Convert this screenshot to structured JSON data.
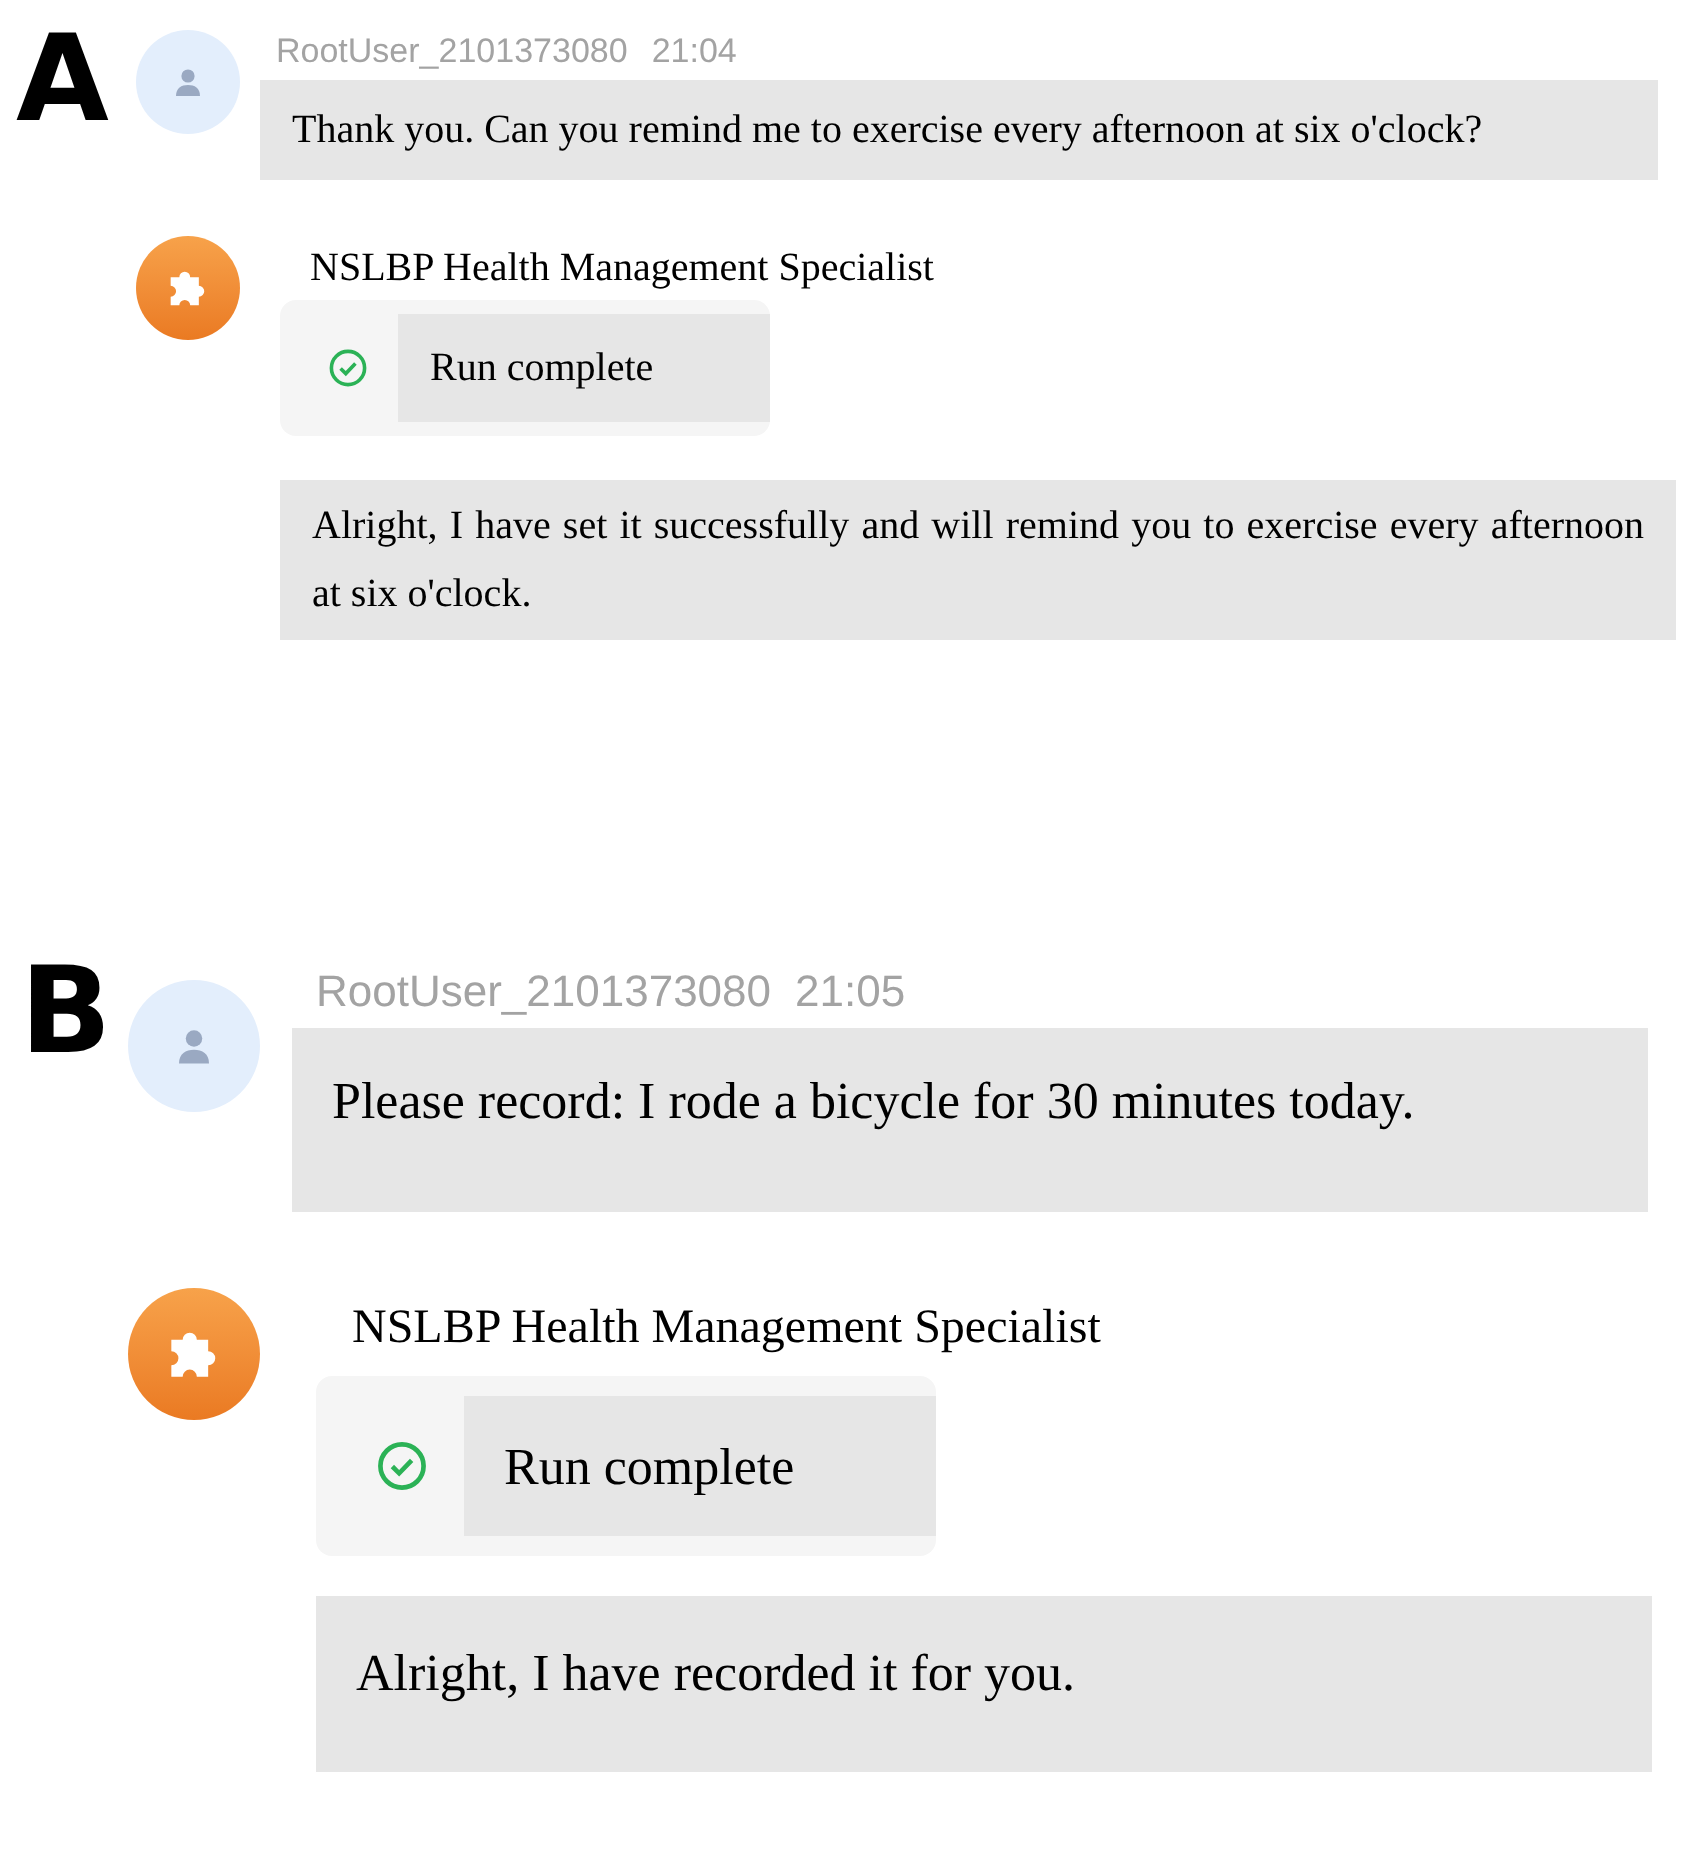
{
  "panels": [
    {
      "label": "A",
      "user": {
        "username": "RootUser_2101373080",
        "time": "21:04",
        "text": "Thank you. Can you remind me to exercise every afternoon at six o'clock?"
      },
      "bot": {
        "name": "NSLBP Health Management Specialist",
        "status": "Run complete",
        "reply": "Alright, I have set it successfully and will remind you to exercise every afternoon at six o'clock."
      }
    },
    {
      "label": "B",
      "user": {
        "username": "RootUser_2101373080",
        "time": "21:05",
        "text": "Please record: I rode a bicycle for 30 minutes today."
      },
      "bot": {
        "name": "NSLBP Health Management Specialist",
        "status": "Run complete",
        "reply": "Alright, I have recorded it for you."
      }
    }
  ]
}
